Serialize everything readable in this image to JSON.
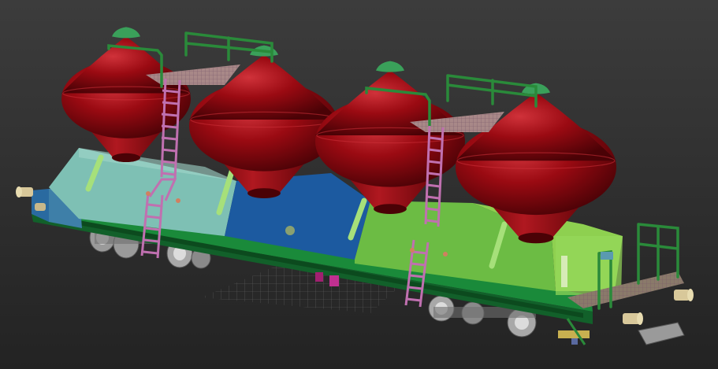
{
  "viewport": {
    "background_top": "#3c3c3c",
    "background_bottom": "#232323"
  },
  "scene": {
    "silo_count": 4,
    "colors": {
      "silo_red": "#9a0a12",
      "silo_highlight": "#d0323a",
      "silo_shadow": "#4a0206",
      "cap_green": "#3aa05a",
      "railing_green": "#2a8a3a",
      "ladder_pink": "#c070b0",
      "panel_teal": "#7ec0b4",
      "panel_blue": "#1c5aa0",
      "panel_green": "#6cbc44",
      "panel_lightgreen": "#8ed050",
      "chassis_green": "#1a8a3a",
      "chassis_dark": "#12602a",
      "walkway": "#a88888",
      "wheel": "#b8b8b8",
      "grid": "#6a6a6a",
      "pipe": "#a6e07a",
      "buffer": "#d8c89a"
    }
  }
}
